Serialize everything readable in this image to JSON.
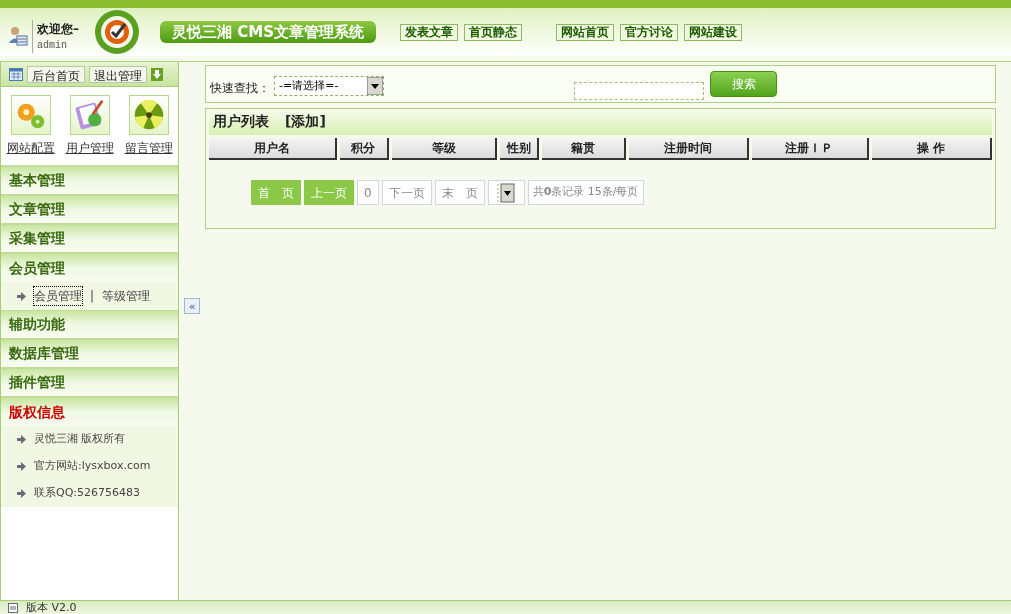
{
  "header": {
    "welcome": "欢迎您–",
    "user": "admin",
    "title": "灵悦三湘 CMS文章管理系统",
    "nav": [
      [
        "发表文章",
        "首页静态"
      ],
      [
        "网站首页",
        "官方讨论",
        "网站建设"
      ]
    ]
  },
  "sidebar": {
    "toolbar": [
      "后台首页",
      "退出管理"
    ],
    "shortcuts": [
      {
        "label": "网站配置",
        "kind": "gears"
      },
      {
        "label": "用户管理",
        "kind": "clipboard"
      },
      {
        "label": "留言管理",
        "kind": "ball"
      }
    ],
    "sections": [
      {
        "title": "基本管理",
        "expanded": false,
        "emphasized": false
      },
      {
        "title": "文章管理",
        "expanded": false,
        "emphasized": false
      },
      {
        "title": "采集管理",
        "expanded": false,
        "emphasized": false
      },
      {
        "title": "会员管理",
        "expanded": true,
        "emphasized": false,
        "links": [
          {
            "label": "会员管理",
            "selected": true
          },
          {
            "label": "等级管理",
            "selected": false
          }
        ],
        "separator": "|"
      },
      {
        "title": "辅助功能",
        "expanded": false,
        "emphasized": false
      },
      {
        "title": "数据库管理",
        "expanded": false,
        "emphasized": false
      },
      {
        "title": "插件管理",
        "expanded": false,
        "emphasized": false
      },
      {
        "title": "版权信息",
        "expanded": true,
        "emphasized": true,
        "lines": [
          "灵悦三湘 版权所有",
          "官方网站:lysxbox.com",
          "联系QQ:526756483"
        ]
      }
    ]
  },
  "collapse_button": "«",
  "search": {
    "label": "快速查找：",
    "select": "-=请选择=-",
    "button": "搜索"
  },
  "user_list": {
    "title": "用户列表",
    "add": "[添加]",
    "columns": [
      "用户名",
      "积分",
      "等级",
      "性别",
      "籍贯",
      "注册时间",
      "注册ＩＰ",
      "操 作"
    ],
    "pagination": {
      "buttons": [
        {
          "label": "首　页",
          "enabled": true
        },
        {
          "label": "上一页",
          "enabled": true
        },
        {
          "label": "0",
          "enabled": false
        },
        {
          "label": "下一页",
          "enabled": false
        },
        {
          "label": "末　页",
          "enabled": false
        }
      ],
      "summary": "共**0**条记录 15条/每页"
    }
  },
  "status_bar": {
    "version": "版本 V2.0"
  }
}
